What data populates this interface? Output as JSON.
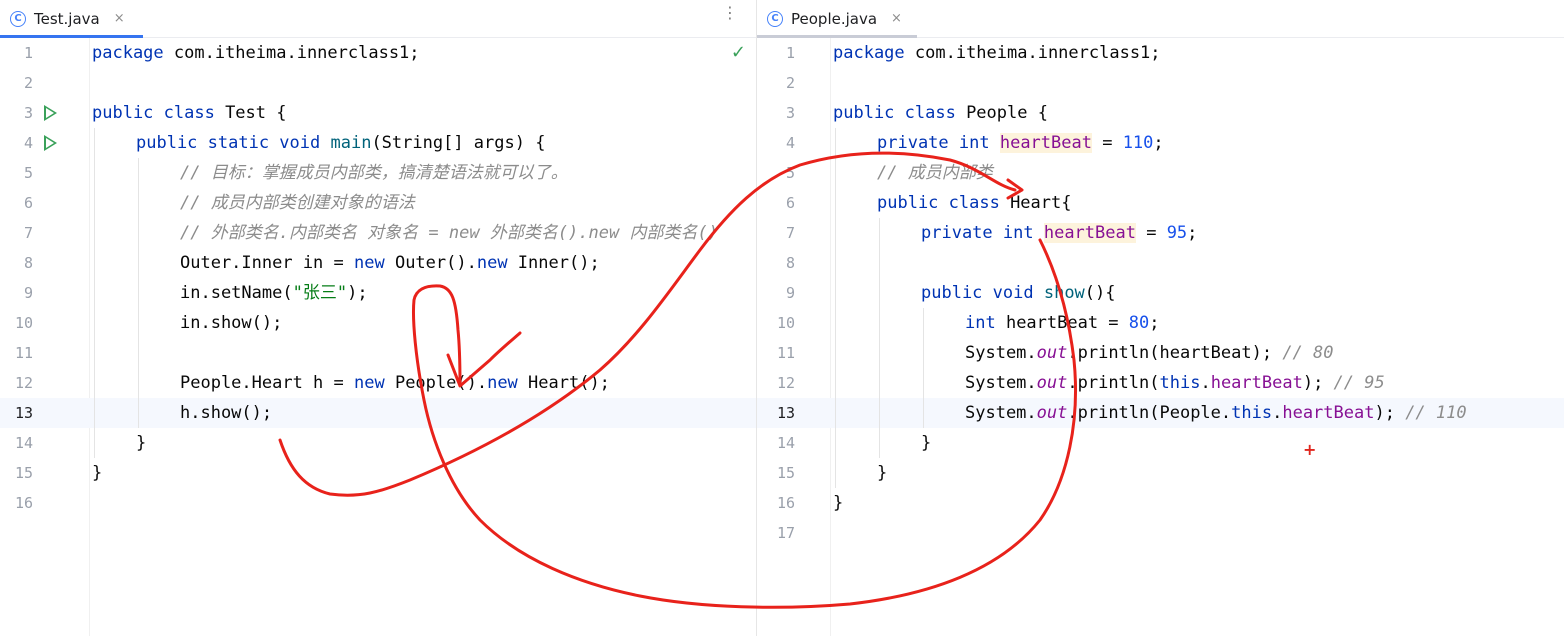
{
  "left": {
    "tab": {
      "icon_letter": "C",
      "label": "Test.java",
      "close": "×"
    },
    "more": "⋮",
    "check": "✓",
    "lines": [
      {
        "n": "1",
        "indent": 0,
        "code": [
          [
            "package",
            "kw"
          ],
          [
            " com.itheima.innerclass1;",
            ""
          ]
        ]
      },
      {
        "n": "2",
        "indent": 0,
        "code": []
      },
      {
        "n": "3",
        "indent": 0,
        "run": true,
        "code": [
          [
            "public class",
            "kw"
          ],
          [
            " Test {",
            ""
          ]
        ]
      },
      {
        "n": "4",
        "indent": 1,
        "run": true,
        "code": [
          [
            "public static void",
            "kw"
          ],
          [
            " ",
            ""
          ],
          [
            "main",
            "mth"
          ],
          [
            "(String[] args) {",
            ""
          ]
        ]
      },
      {
        "n": "5",
        "indent": 2,
        "code": [
          [
            "// 目标：掌握成员内部类，搞清楚语法就可以了。",
            "cm"
          ]
        ]
      },
      {
        "n": "6",
        "indent": 2,
        "code": [
          [
            "// 成员内部类创建对象的语法",
            "cm"
          ]
        ]
      },
      {
        "n": "7",
        "indent": 2,
        "code": [
          [
            "// 外部类名.内部类名 对象名 = new 外部类名().new 内部类名()",
            "cm"
          ]
        ]
      },
      {
        "n": "8",
        "indent": 2,
        "code": [
          [
            "Outer.Inner in = ",
            ""
          ],
          [
            "new",
            "kw"
          ],
          [
            " Outer().",
            ""
          ],
          [
            "new",
            "kw"
          ],
          [
            " Inner();",
            ""
          ]
        ]
      },
      {
        "n": "9",
        "indent": 2,
        "code": [
          [
            "in.setName(",
            ""
          ],
          [
            "\"张三\"",
            "str"
          ],
          [
            ");",
            ""
          ]
        ]
      },
      {
        "n": "10",
        "indent": 2,
        "code": [
          [
            "in.show();",
            ""
          ]
        ]
      },
      {
        "n": "11",
        "indent": 0,
        "code": []
      },
      {
        "n": "12",
        "indent": 2,
        "code": [
          [
            "People.Heart h = ",
            ""
          ],
          [
            "new",
            "kw"
          ],
          [
            " People().",
            ""
          ],
          [
            "new",
            "kw"
          ],
          [
            " Heart();",
            ""
          ]
        ]
      },
      {
        "n": "13",
        "indent": 2,
        "current": true,
        "code": [
          [
            "h.show();",
            ""
          ]
        ]
      },
      {
        "n": "14",
        "indent": 1,
        "code": [
          [
            "}",
            ""
          ]
        ]
      },
      {
        "n": "15",
        "indent": 0,
        "code": [
          [
            "}",
            ""
          ]
        ]
      },
      {
        "n": "16",
        "indent": 0,
        "code": []
      }
    ]
  },
  "right": {
    "tab": {
      "icon_letter": "C",
      "label": "People.java",
      "close": "×"
    },
    "lines": [
      {
        "n": "1",
        "indent": 0,
        "code": [
          [
            "package",
            "kw"
          ],
          [
            " com.itheima.innerclass1;",
            ""
          ]
        ]
      },
      {
        "n": "2",
        "indent": 0,
        "code": []
      },
      {
        "n": "3",
        "indent": 0,
        "code": [
          [
            "public class",
            "kw"
          ],
          [
            " People {",
            ""
          ]
        ]
      },
      {
        "n": "4",
        "indent": 1,
        "code": [
          [
            "private int",
            "kw"
          ],
          [
            " ",
            ""
          ],
          [
            "heartBeat",
            "fld hl"
          ],
          [
            " = ",
            ""
          ],
          [
            "110",
            "num"
          ],
          [
            ";",
            ""
          ]
        ]
      },
      {
        "n": "5",
        "indent": 1,
        "code": [
          [
            "// 成员内部类",
            "cm"
          ]
        ]
      },
      {
        "n": "6",
        "indent": 1,
        "code": [
          [
            "public class",
            "kw"
          ],
          [
            " Heart{",
            ""
          ]
        ]
      },
      {
        "n": "7",
        "indent": 2,
        "code": [
          [
            "private int",
            "kw"
          ],
          [
            " ",
            ""
          ],
          [
            "heartBeat",
            "fld hl"
          ],
          [
            " = ",
            ""
          ],
          [
            "95",
            "num"
          ],
          [
            ";",
            ""
          ]
        ]
      },
      {
        "n": "8",
        "indent": 0,
        "code": []
      },
      {
        "n": "9",
        "indent": 2,
        "code": [
          [
            "public void",
            "kw"
          ],
          [
            " ",
            ""
          ],
          [
            "show",
            "mth"
          ],
          [
            "(){",
            ""
          ]
        ]
      },
      {
        "n": "10",
        "indent": 3,
        "code": [
          [
            "int",
            "kw"
          ],
          [
            " heartBeat = ",
            ""
          ],
          [
            "80",
            "num"
          ],
          [
            ";",
            ""
          ]
        ]
      },
      {
        "n": "11",
        "indent": 3,
        "code": [
          [
            "System.",
            ""
          ],
          [
            "out",
            "fld cm"
          ],
          [
            ".println(heartBeat); ",
            ""
          ],
          [
            "// 80",
            "cm"
          ]
        ]
      },
      {
        "n": "12",
        "indent": 3,
        "code": [
          [
            "System.",
            ""
          ],
          [
            "out",
            "fld cm"
          ],
          [
            ".println(",
            ""
          ],
          [
            "this",
            "kw"
          ],
          [
            ".",
            ""
          ],
          [
            "heartBeat",
            "fld"
          ],
          [
            "); ",
            ""
          ],
          [
            "// 95",
            "cm"
          ]
        ]
      },
      {
        "n": "13",
        "indent": 3,
        "current": true,
        "code": [
          [
            "System.",
            ""
          ],
          [
            "out",
            "fld cm"
          ],
          [
            ".println(People.",
            ""
          ],
          [
            "this",
            "kw"
          ],
          [
            ".",
            ""
          ],
          [
            "heartBeat",
            "fld"
          ],
          [
            "); ",
            ""
          ],
          [
            "// 110",
            "cm"
          ]
        ]
      },
      {
        "n": "14",
        "indent": 2,
        "code": [
          [
            "}",
            ""
          ]
        ]
      },
      {
        "n": "15",
        "indent": 1,
        "code": [
          [
            "}",
            ""
          ]
        ]
      },
      {
        "n": "16",
        "indent": 0,
        "code": [
          [
            "}",
            ""
          ]
        ]
      },
      {
        "n": "17",
        "indent": 0,
        "code": []
      }
    ]
  },
  "annotation_plus": "+",
  "ink_color": "#e8221b"
}
